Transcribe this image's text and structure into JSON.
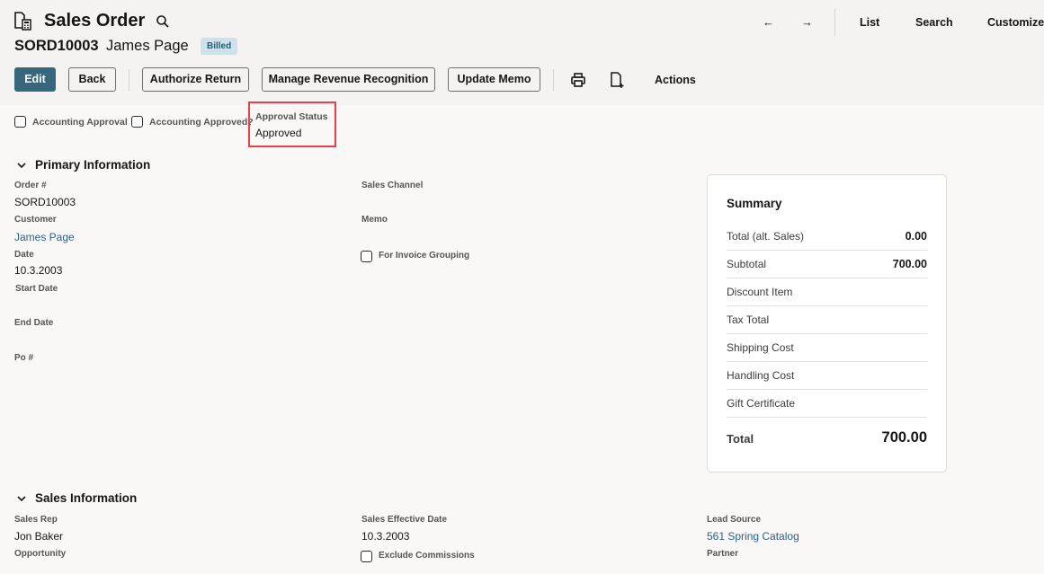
{
  "header": {
    "title": "Sales Order",
    "record_number": "SORD10003",
    "record_name": "James Page",
    "status": "Billed",
    "nav": {
      "prev_icon": "arrow-left-icon",
      "next_icon": "arrow-right-icon",
      "links": [
        "List",
        "Search",
        "Customize"
      ]
    }
  },
  "toolbar": {
    "edit_label": "Edit",
    "back_label": "Back",
    "authorize_return_label": "Authorize Return",
    "manage_revenue_label": "Manage Revenue Recognition",
    "update_memo_label": "Update Memo",
    "actions_label": "Actions",
    "icons": [
      "print-icon",
      "new-document-icon"
    ]
  },
  "approval": {
    "accounting_approval_label": "Accounting Approval",
    "accounting_approval_checked": false,
    "accounting_approved_label": "Accounting Approved?",
    "accounting_approved_checked": false,
    "status_label": "Approval Status",
    "status_value": "Approved"
  },
  "primary": {
    "title": "Primary Information",
    "order_label": "Order #",
    "order_value": "SORD10003",
    "customer_label": "Customer",
    "customer_value": "James Page",
    "date_label": "Date",
    "date_value": "10.3.2003",
    "start_date_label": "Start Date",
    "start_date_value": "",
    "end_date_label": "End Date",
    "end_date_value": "",
    "po_label": "Po #",
    "po_value": "",
    "sales_channel_label": "Sales Channel",
    "sales_channel_value": "",
    "memo_label": "Memo",
    "memo_value": "",
    "invoice_grouping_label": "For Invoice Grouping",
    "invoice_grouping_checked": false
  },
  "summary": {
    "title": "Summary",
    "rows": [
      {
        "label": "Total (alt. Sales)",
        "value": "0.00"
      },
      {
        "label": "Subtotal",
        "value": "700.00"
      },
      {
        "label": "Discount Item",
        "value": ""
      },
      {
        "label": "Tax Total",
        "value": ""
      },
      {
        "label": "Shipping Cost",
        "value": ""
      },
      {
        "label": "Handling Cost",
        "value": ""
      },
      {
        "label": "Gift Certificate",
        "value": ""
      }
    ],
    "total_label": "Total",
    "total_value": "700.00"
  },
  "sales": {
    "title": "Sales Information",
    "sales_rep_label": "Sales Rep",
    "sales_rep_value": "Jon Baker",
    "opportunity_label": "Opportunity",
    "opportunity_value": "",
    "effective_date_label": "Sales Effective Date",
    "effective_date_value": "10.3.2003",
    "exclude_commissions_label": "Exclude Commissions",
    "exclude_commissions_checked": false,
    "lead_source_label": "Lead Source",
    "lead_source_value": "561 Spring Catalog",
    "partner_label": "Partner",
    "partner_value": ""
  },
  "colors": {
    "primary_button": "#36677d",
    "link": "#2c6183",
    "badge_bg": "#cfe1ea",
    "badge_text": "#205e78",
    "highlight_border": "#e8404a"
  }
}
